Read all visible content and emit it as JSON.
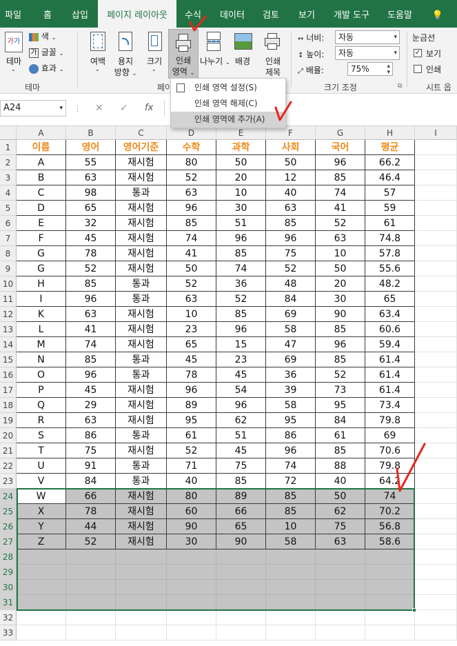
{
  "ribbon_tabs": [
    "파일",
    "홈",
    "삽입",
    "페이지 레이아웃",
    "수식",
    "데이터",
    "검토",
    "보기",
    "개발 도구",
    "도움말",
    "💡"
  ],
  "active_tab_index": 3,
  "theme_group": {
    "theme_label": "테마",
    "colors_label": "색",
    "fonts_label": "글꼴",
    "effects_label": "효과",
    "group_label": "테마"
  },
  "page_setup_group": {
    "margins_label": "여백",
    "orientation_label_1": "용지",
    "orientation_label_2": "방향",
    "size_label": "크기",
    "print_area_label_1": "인쇄",
    "print_area_label_2": "영역",
    "breaks_label": "나누기",
    "background_label": "배경",
    "print_titles_label_1": "인쇄",
    "print_titles_label_2": "제목",
    "group_label": "페이"
  },
  "scale_group": {
    "width_label": "너비:",
    "width_value": "자동",
    "height_label": "높이:",
    "height_value": "자동",
    "scale_label": "배율:",
    "scale_value": "75%",
    "group_label": "크기 조정"
  },
  "sheet_options_group": {
    "gridlines_label": "눈금선",
    "view_label": "보기",
    "view_checked": true,
    "print_label": "인쇄",
    "print_checked": false,
    "group_label": "시트 옵"
  },
  "print_area_menu": [
    {
      "label": "인쇄 영역 설정(S)"
    },
    {
      "label": "인쇄 영역 해제(C)"
    },
    {
      "label": "인쇄 영역에 추가(A)"
    }
  ],
  "name_box": "A24",
  "formula_buttons": {
    "cancel": "✕",
    "enter": "✓",
    "function": "fx"
  },
  "columns": [
    "A",
    "B",
    "C",
    "D",
    "E",
    "F",
    "G",
    "H",
    "I"
  ],
  "table_headers": [
    "이름",
    "영어",
    "영어기준",
    "수학",
    "과학",
    "사회",
    "국어",
    "평균"
  ],
  "rows": [
    [
      "A",
      "55",
      "재시험",
      "80",
      "50",
      "50",
      "96",
      "66.2"
    ],
    [
      "B",
      "63",
      "재시험",
      "52",
      "20",
      "12",
      "85",
      "46.4"
    ],
    [
      "C",
      "98",
      "통과",
      "63",
      "10",
      "40",
      "74",
      "57"
    ],
    [
      "D",
      "65",
      "재시험",
      "96",
      "30",
      "63",
      "41",
      "59"
    ],
    [
      "E",
      "32",
      "재시험",
      "85",
      "51",
      "85",
      "52",
      "61"
    ],
    [
      "F",
      "45",
      "재시험",
      "74",
      "96",
      "96",
      "63",
      "74.8"
    ],
    [
      "G",
      "78",
      "재시험",
      "41",
      "85",
      "75",
      "10",
      "57.8"
    ],
    [
      "G",
      "52",
      "재시험",
      "50",
      "74",
      "52",
      "50",
      "55.6"
    ],
    [
      "H",
      "85",
      "통과",
      "52",
      "36",
      "48",
      "20",
      "48.2"
    ],
    [
      "I",
      "96",
      "통과",
      "63",
      "52",
      "84",
      "30",
      "65"
    ],
    [
      "K",
      "63",
      "재시험",
      "10",
      "85",
      "69",
      "90",
      "63.4"
    ],
    [
      "L",
      "41",
      "재시험",
      "23",
      "96",
      "58",
      "85",
      "60.6"
    ],
    [
      "M",
      "74",
      "재시험",
      "65",
      "15",
      "47",
      "96",
      "59.4"
    ],
    [
      "N",
      "85",
      "통과",
      "45",
      "23",
      "69",
      "85",
      "61.4"
    ],
    [
      "O",
      "96",
      "통과",
      "78",
      "45",
      "36",
      "52",
      "61.4"
    ],
    [
      "P",
      "45",
      "재시험",
      "96",
      "54",
      "39",
      "73",
      "61.4"
    ],
    [
      "Q",
      "29",
      "재시험",
      "89",
      "96",
      "58",
      "95",
      "73.4"
    ],
    [
      "R",
      "63",
      "재시험",
      "95",
      "62",
      "95",
      "84",
      "79.8"
    ],
    [
      "S",
      "86",
      "통과",
      "61",
      "51",
      "86",
      "61",
      "69"
    ],
    [
      "T",
      "75",
      "재시험",
      "52",
      "45",
      "96",
      "85",
      "70.6"
    ],
    [
      "U",
      "91",
      "통과",
      "71",
      "75",
      "74",
      "88",
      "79.8"
    ],
    [
      "V",
      "84",
      "통과",
      "40",
      "85",
      "72",
      "40",
      "64.2"
    ],
    [
      "W",
      "66",
      "재시험",
      "80",
      "89",
      "85",
      "50",
      "74"
    ],
    [
      "X",
      "78",
      "재시험",
      "60",
      "66",
      "85",
      "62",
      "70.2"
    ],
    [
      "Y",
      "44",
      "재시험",
      "90",
      "65",
      "10",
      "75",
      "56.8"
    ],
    [
      "Z",
      "52",
      "재시험",
      "30",
      "90",
      "58",
      "63",
      "58.6"
    ]
  ],
  "row_numbers": [
    "1",
    "2",
    "3",
    "4",
    "5",
    "6",
    "7",
    "8",
    "9",
    "10",
    "11",
    "12",
    "13",
    "14",
    "15",
    "16",
    "17",
    "18",
    "19",
    "20",
    "21",
    "22",
    "23",
    "24",
    "25",
    "26",
    "27",
    "28",
    "29",
    "30",
    "31",
    "32",
    "33"
  ],
  "colors": {
    "accent": "#217346",
    "header_text": "#f08a1a",
    "selection_fill": "#c4c4c4",
    "annotation": "#e8261c"
  }
}
